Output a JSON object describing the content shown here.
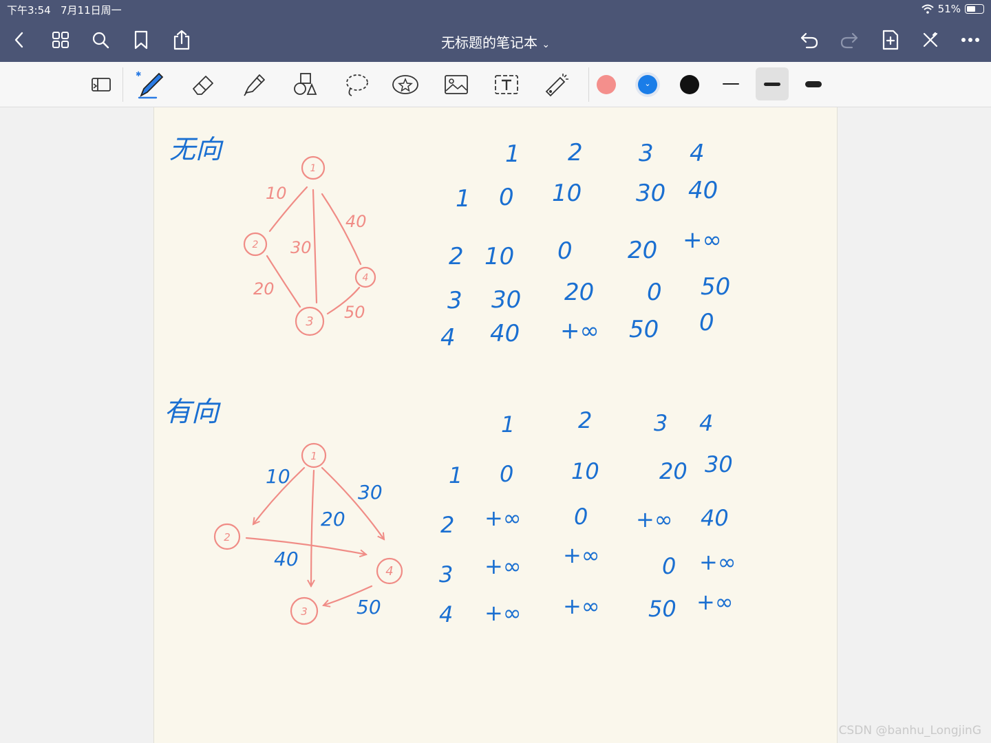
{
  "status": {
    "time": "下午3:54",
    "date": "7月11日周一",
    "battery": "51%"
  },
  "nav": {
    "title": "无标题的笔记本",
    "icons": [
      "back-icon",
      "grid-icon",
      "search-icon",
      "bookmark-icon",
      "share-icon",
      "undo-icon",
      "redo-icon",
      "add-page-icon",
      "close-pen-icon",
      "more-icon"
    ]
  },
  "colors": {
    "bar": "#4b5575",
    "ink_blue": "#1a6fd1",
    "ink_red": "#f08c86",
    "swatch_pink": "#f48f8c",
    "swatch_blue": "#1a7de8",
    "swatch_black": "#111111"
  },
  "note": {
    "undirected": {
      "heading": "无向",
      "nodes": [
        "1",
        "2",
        "3",
        "4"
      ],
      "edge_labels": [
        "10",
        "40",
        "30",
        "20",
        "50"
      ],
      "matrix": {
        "col_headers": [
          "1",
          "2",
          "3",
          "4"
        ],
        "rows": [
          {
            "head": "1",
            "cells": [
              "0",
              "10",
              "30",
              "40"
            ]
          },
          {
            "head": "2",
            "cells": [
              "10",
              "0",
              "20",
              "+∞"
            ]
          },
          {
            "head": "3",
            "cells": [
              "30",
              "20",
              "0",
              "50"
            ]
          },
          {
            "head": "4",
            "cells": [
              "40",
              "+∞",
              "50",
              "0"
            ]
          }
        ]
      }
    },
    "directed": {
      "heading": "有向",
      "nodes": [
        "1",
        "2",
        "3",
        "4"
      ],
      "edge_labels": [
        "10",
        "30",
        "20",
        "40",
        "50"
      ],
      "matrix": {
        "col_headers": [
          "1",
          "2",
          "3",
          "4"
        ],
        "rows": [
          {
            "head": "1",
            "cells": [
              "0",
              "10",
              "20",
              "30"
            ]
          },
          {
            "head": "2",
            "cells": [
              "+∞",
              "0",
              "+∞",
              "40"
            ]
          },
          {
            "head": "3",
            "cells": [
              "+∞",
              "+∞",
              "0",
              "+∞"
            ]
          },
          {
            "head": "4",
            "cells": [
              "+∞",
              "+∞",
              "50",
              "+∞"
            ]
          }
        ]
      }
    }
  },
  "watermark": "CSDN @banhu_LongjinG"
}
